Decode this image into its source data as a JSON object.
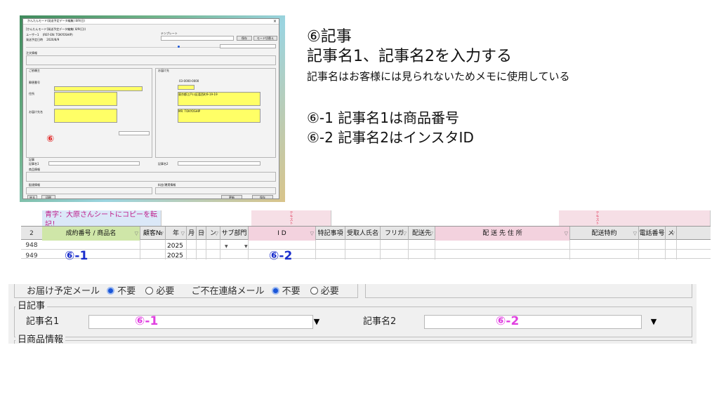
{
  "thumbnail": {
    "title_bar": "かんたんモード(発送予定データ編集) 8/9(日)",
    "close_glyph": "×",
    "header_line": "[かんたんモード]発送予定データ編集( 8/9(日))",
    "user_label": "ユーザー1",
    "user_id_label": "(REF-EN: TOKYOSHIP)",
    "date_label": "発送予定日時",
    "date_value": "2020/8/9",
    "template_label": "テンプレート",
    "save_button": "保存",
    "mode_button": "モード切替え",
    "section_order": "注文情報",
    "section_sender": "ご依頼主",
    "section_recipient": "お届け先",
    "postal_label": "郵便番号",
    "address_label": "住所",
    "name_label": "お届け先名",
    "phone_value": "03-0000-0000",
    "recipient_address": "東京都江戸川区葛西町9-19-19",
    "recipient_name": "MR. TOKYOSHIP",
    "kiji_section": "記事",
    "kiji_row_label": "記事名1",
    "kiji_row_label2": "記事名2",
    "product_section": "商品情報",
    "delivery_section": "配達情報",
    "payment_section": "料金/運賃情報",
    "footer_left": "戻る",
    "footer_left2": "印刷",
    "footer_right": "更新",
    "footer_right2": "保存",
    "marker": "⑥"
  },
  "explanation": {
    "title": "⑥記事",
    "line1": "記事名1、記事名2を入力する",
    "line2": "記事名はお客様には見られないためメモに使用している",
    "line3": "⑥-1 記事名1は商品番号",
    "line4": "⑥-2 記事名2はインスタID"
  },
  "sheet": {
    "note": "青字：大原さんシートにコピーを転記！",
    "pink_marker": "テキスト",
    "row_header_num": "2",
    "headers": [
      {
        "label": "成約番号 / 商品名"
      },
      {
        "label": "顧客№"
      },
      {
        "label": "年"
      },
      {
        "label": "月"
      },
      {
        "label": "日"
      },
      {
        "label": "ン"
      },
      {
        "label": "サブ部門"
      },
      {
        "label": "I D"
      },
      {
        "label": "特記事項"
      },
      {
        "label": "受取人氏名"
      },
      {
        "label": "フリガ"
      },
      {
        "label": "配送先"
      },
      {
        "label": "配 送 先 住 所"
      },
      {
        "label": "配送特約"
      },
      {
        "label": "電話番号"
      },
      {
        "label": "メ"
      }
    ],
    "rows": [
      {
        "num": "948",
        "year": "2025"
      },
      {
        "num": "949",
        "year": "2025"
      }
    ],
    "label_1": "⑥-1",
    "label_2": "⑥-2"
  },
  "zoom": {
    "top_label": "お届け予定メール",
    "opt_required": "必要",
    "top_label2": "ご不在連絡メール",
    "opt_unneeded": "不要",
    "opt_required2": "必要",
    "opt_unneeded2": "不要",
    "section_title": "日記事",
    "field1_label": "記事名1",
    "field1_marker": "⑥-1",
    "field2_label": "記事名2",
    "field2_marker": "⑥-2",
    "dropdown_glyph": "▼",
    "next_section": "日商品情報"
  },
  "colors": {
    "accent_blue": "#1a2ecc",
    "magenta": "#e040e0",
    "highlight_yellow": "#ffff66",
    "marker_red": "#e02020"
  }
}
